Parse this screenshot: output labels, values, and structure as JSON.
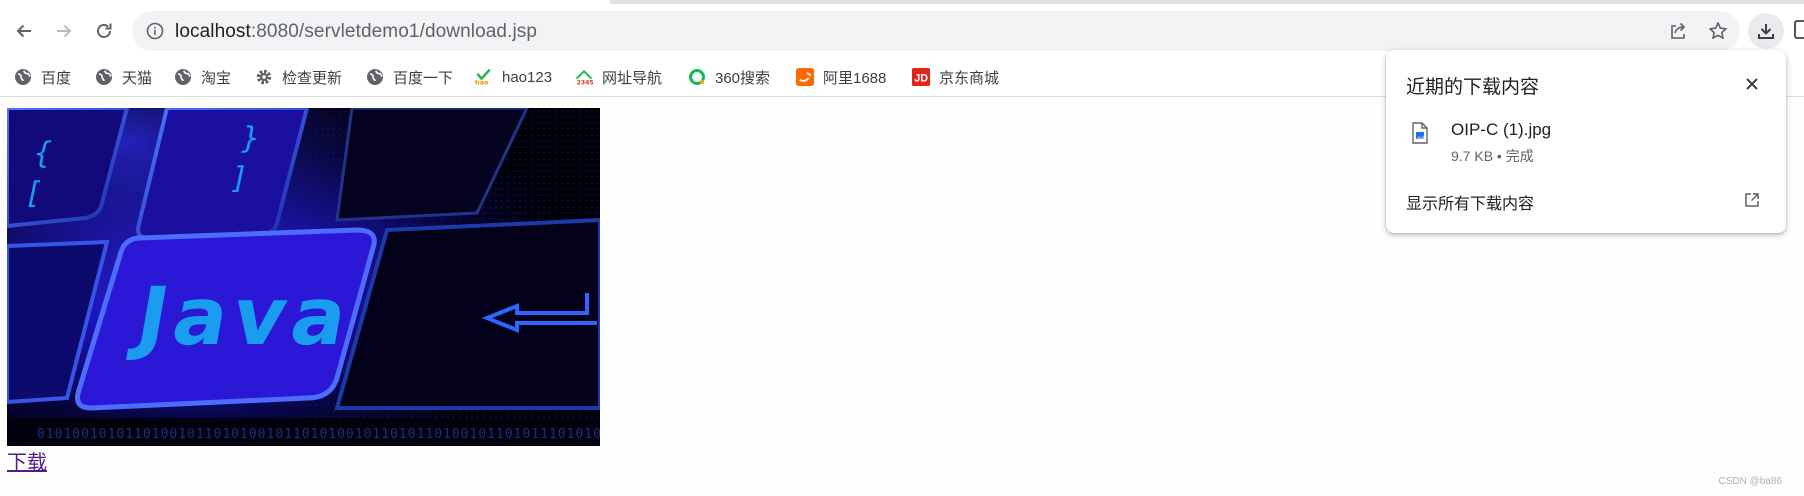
{
  "browser": {
    "url_host": "localhost",
    "url_rest": ":8080/servletdemo1/download.jsp"
  },
  "bookmarks": [
    {
      "label": "百度",
      "icon": "globe-icon"
    },
    {
      "label": "天猫",
      "icon": "globe-icon"
    },
    {
      "label": "淘宝",
      "icon": "globe-icon"
    },
    {
      "label": "检查更新",
      "icon": "gear-icon"
    },
    {
      "label": "百度一下",
      "icon": "globe-icon"
    },
    {
      "label": "hao123",
      "icon": "hao123-icon"
    },
    {
      "label": "网址导航",
      "icon": "2345-icon"
    },
    {
      "label": "360搜索",
      "icon": "360-icon"
    },
    {
      "label": "阿里1688",
      "icon": "1688-icon"
    },
    {
      "label": "京东商城",
      "icon": "jd-icon"
    }
  ],
  "page": {
    "image_text": "Java",
    "download_link": "下载",
    "watermark": "CSDN @ba86"
  },
  "downloads_panel": {
    "title": "近期的下载内容",
    "file_name": "OIP-C (1).jpg",
    "file_meta": "9.7 KB • 完成",
    "show_all": "显示所有下载内容"
  },
  "colors": {
    "link_visited": "#551a8b",
    "key_glow": "#1e3cff",
    "key_text": "#1a9cf0"
  }
}
